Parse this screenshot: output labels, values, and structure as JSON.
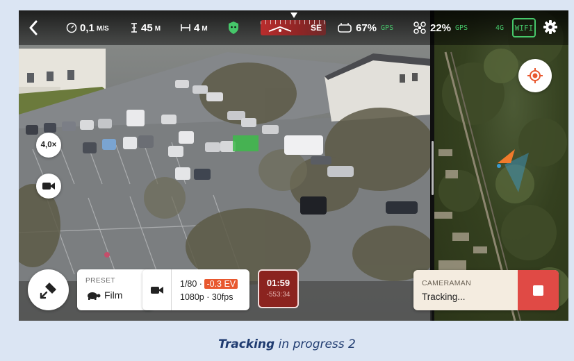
{
  "status_bar": {
    "back_icon": "chevron-left-icon",
    "speed": {
      "value": "0,1",
      "unit": "M/S",
      "icon": "speedometer-icon"
    },
    "altitude": {
      "value": "45",
      "unit": "M",
      "icon": "altitude-icon"
    },
    "distance": {
      "value": "4",
      "unit": "M",
      "icon": "horizontal-distance-icon"
    },
    "shield_icon": "shield-check-icon",
    "heading": "SE",
    "controller": {
      "battery": "67%",
      "gps": "GPS",
      "icon": "controller-icon"
    },
    "drone": {
      "battery": "22%",
      "gps": "GPS",
      "icon": "drone-icon"
    },
    "network": {
      "cellular": "4G",
      "wifi": "WIFI"
    },
    "settings_icon": "gear-icon"
  },
  "camera": {
    "zoom": "4,0×",
    "camera_mode_icon": "video-camera-icon",
    "target_box_color": "#3dbb4a"
  },
  "map": {
    "recenter_icon": "target-icon",
    "drone_marker_color": "#f07a2b"
  },
  "bottom": {
    "toggle_icon": "drone-toggle-icon",
    "preset": {
      "label": "PRESET",
      "value": "Film",
      "icon": "turtle-icon"
    },
    "exposure": {
      "shutter": "1/80 ·",
      "ev": "-0.3 EV",
      "format": "1080p · 30fps",
      "icon": "video-icon"
    },
    "recording": {
      "elapsed": "01:59",
      "remaining": "-553:34"
    },
    "cameraman": {
      "title": "CAMERAMAN",
      "status": "Tracking...",
      "stop_icon": "stop-icon"
    }
  },
  "caption": {
    "bold": "Tracking",
    "rest": " in progress 2"
  },
  "colors": {
    "accent_green": "#46c76a",
    "stop_red": "#e04a45",
    "rec_red": "#8b231f",
    "ev_orange": "#e8582f"
  }
}
